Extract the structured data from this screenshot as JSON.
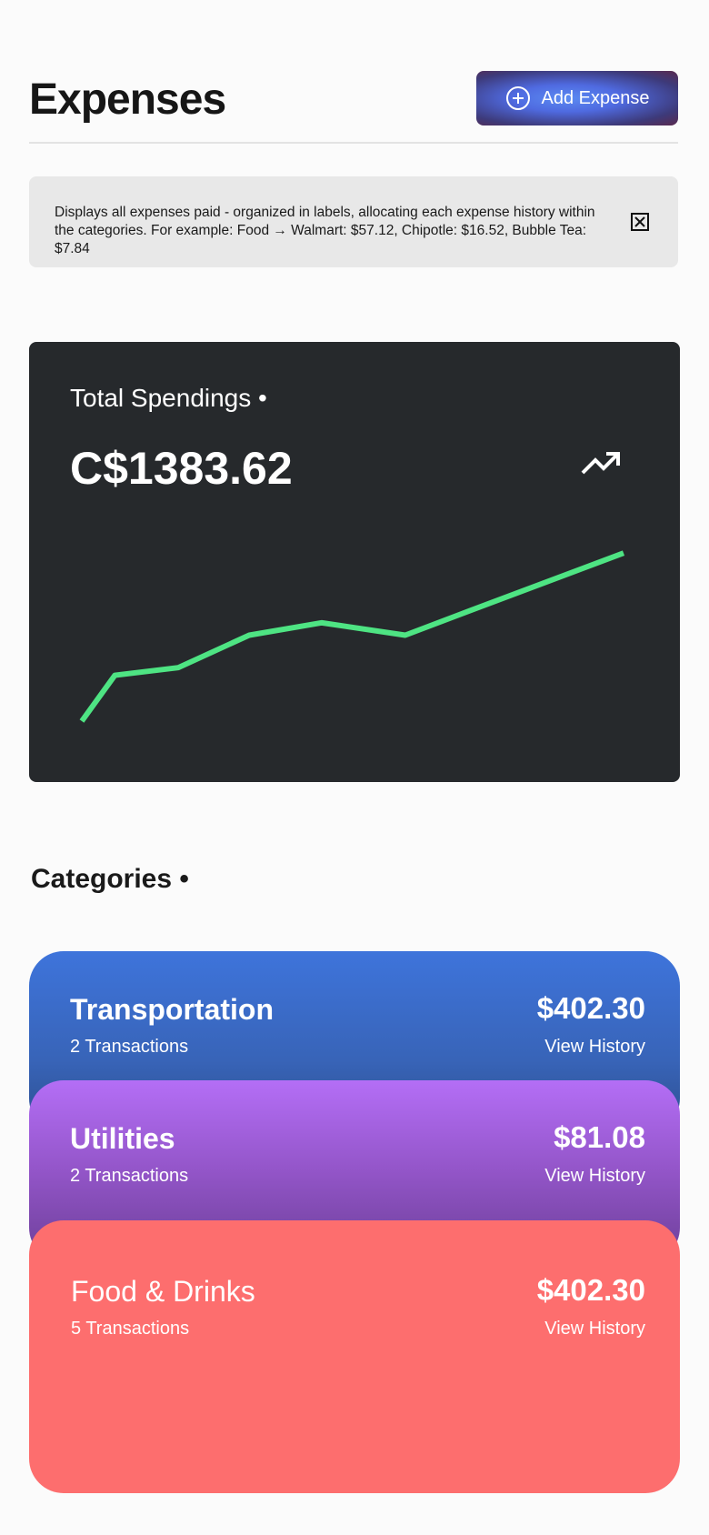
{
  "header": {
    "title": "Expenses",
    "add_button_label": "Add Expense"
  },
  "info": {
    "text": "Displays all expenses paid - organized in labels, allocating each expense history within the categories. For example: Food → Walmart: $57.12, Chipotle: $16.52, Bubble Tea: $7.84"
  },
  "spendings": {
    "label": "Total Spendings •",
    "value": "C$1383.62",
    "line_color": "#4ee483"
  },
  "chart_data": {
    "type": "line",
    "title": "",
    "xlabel": "",
    "ylabel": "",
    "x": [
      1,
      2,
      3,
      4,
      5,
      6,
      7,
      8
    ],
    "values": [
      0,
      48,
      56,
      90,
      103,
      90,
      116,
      176
    ],
    "ylim": [
      0,
      180
    ],
    "grid": false
  },
  "categories": {
    "title": "Categories •",
    "items": [
      {
        "name": "Transportation",
        "count": "2 Transactions",
        "amount": "$402.30",
        "history": "View History"
      },
      {
        "name": "Utilities",
        "count": "2 Transactions",
        "amount": "$81.08",
        "history": "View History"
      },
      {
        "name": "Food & Drinks",
        "count": "5 Transactions",
        "amount": "$402.30",
        "history": "View History"
      }
    ]
  },
  "icons": {
    "add": "plus-circle-icon",
    "close": "close-box-icon",
    "trend": "trending-up-icon"
  }
}
